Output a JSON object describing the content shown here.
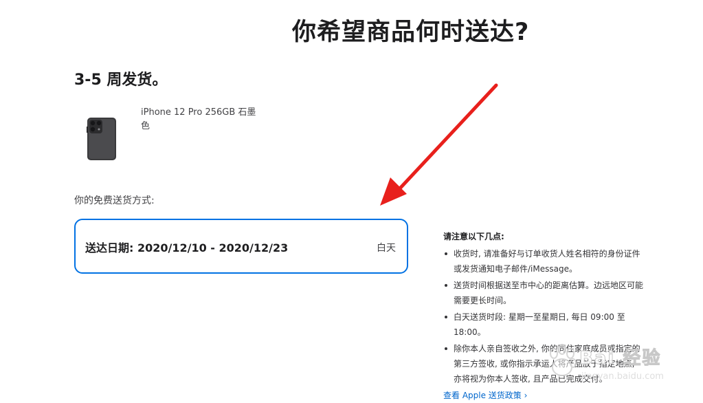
{
  "page": {
    "title": "你希望商品何时送达?",
    "ship_time": "3-5 周发货。"
  },
  "product": {
    "name": "iPhone 12 Pro 256GB 石墨色",
    "image_icon": "iphone-12-pro-graphite"
  },
  "delivery": {
    "label": "你的免费送货方式:",
    "option": {
      "date_text": "送达日期: 2020/12/10 - 2020/12/23",
      "slot": "白天",
      "selected": true
    }
  },
  "notes": {
    "title": "请注意以下几点:",
    "items": [
      "收货时, 请准备好与订单收货人姓名相符的身份证件或发货通知电子邮件/iMessage。",
      "送货时间根据送至市中心的距离估算。边远地区可能需要更长时间。",
      "白天送货时段: 星期一至星期日, 每日 09:00 至 18:00。",
      "除你本人亲自签收之外, 你的同住家庭成员或指定的第三方签收, 或你指示承运人将产品放于指定地点, 亦将视为你本人签收, 且产品已完成交付。"
    ]
  },
  "policy_link": {
    "label": "查看 Apple 送货政策 ›"
  },
  "watermark": {
    "text": "Bai 经验",
    "sub": "jingyan.baidu.com"
  },
  "colors": {
    "accent": "#0071e3",
    "arrow": "#e8201c",
    "text": "#1d1d1f"
  }
}
